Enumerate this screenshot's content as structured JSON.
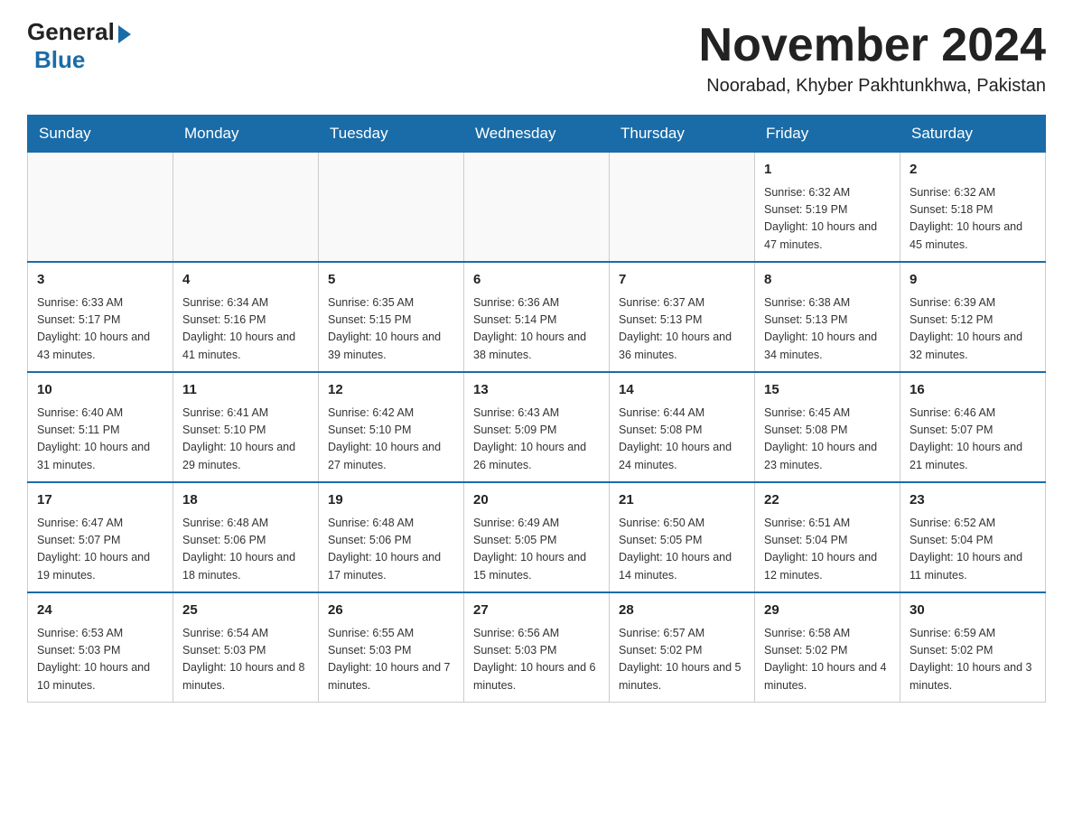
{
  "logo": {
    "general": "General",
    "blue": "Blue"
  },
  "title": "November 2024",
  "location": "Noorabad, Khyber Pakhtunkhwa, Pakistan",
  "days_of_week": [
    "Sunday",
    "Monday",
    "Tuesday",
    "Wednesday",
    "Thursday",
    "Friday",
    "Saturday"
  ],
  "weeks": [
    [
      {
        "day": "",
        "info": ""
      },
      {
        "day": "",
        "info": ""
      },
      {
        "day": "",
        "info": ""
      },
      {
        "day": "",
        "info": ""
      },
      {
        "day": "",
        "info": ""
      },
      {
        "day": "1",
        "info": "Sunrise: 6:32 AM\nSunset: 5:19 PM\nDaylight: 10 hours and 47 minutes."
      },
      {
        "day": "2",
        "info": "Sunrise: 6:32 AM\nSunset: 5:18 PM\nDaylight: 10 hours and 45 minutes."
      }
    ],
    [
      {
        "day": "3",
        "info": "Sunrise: 6:33 AM\nSunset: 5:17 PM\nDaylight: 10 hours and 43 minutes."
      },
      {
        "day": "4",
        "info": "Sunrise: 6:34 AM\nSunset: 5:16 PM\nDaylight: 10 hours and 41 minutes."
      },
      {
        "day": "5",
        "info": "Sunrise: 6:35 AM\nSunset: 5:15 PM\nDaylight: 10 hours and 39 minutes."
      },
      {
        "day": "6",
        "info": "Sunrise: 6:36 AM\nSunset: 5:14 PM\nDaylight: 10 hours and 38 minutes."
      },
      {
        "day": "7",
        "info": "Sunrise: 6:37 AM\nSunset: 5:13 PM\nDaylight: 10 hours and 36 minutes."
      },
      {
        "day": "8",
        "info": "Sunrise: 6:38 AM\nSunset: 5:13 PM\nDaylight: 10 hours and 34 minutes."
      },
      {
        "day": "9",
        "info": "Sunrise: 6:39 AM\nSunset: 5:12 PM\nDaylight: 10 hours and 32 minutes."
      }
    ],
    [
      {
        "day": "10",
        "info": "Sunrise: 6:40 AM\nSunset: 5:11 PM\nDaylight: 10 hours and 31 minutes."
      },
      {
        "day": "11",
        "info": "Sunrise: 6:41 AM\nSunset: 5:10 PM\nDaylight: 10 hours and 29 minutes."
      },
      {
        "day": "12",
        "info": "Sunrise: 6:42 AM\nSunset: 5:10 PM\nDaylight: 10 hours and 27 minutes."
      },
      {
        "day": "13",
        "info": "Sunrise: 6:43 AM\nSunset: 5:09 PM\nDaylight: 10 hours and 26 minutes."
      },
      {
        "day": "14",
        "info": "Sunrise: 6:44 AM\nSunset: 5:08 PM\nDaylight: 10 hours and 24 minutes."
      },
      {
        "day": "15",
        "info": "Sunrise: 6:45 AM\nSunset: 5:08 PM\nDaylight: 10 hours and 23 minutes."
      },
      {
        "day": "16",
        "info": "Sunrise: 6:46 AM\nSunset: 5:07 PM\nDaylight: 10 hours and 21 minutes."
      }
    ],
    [
      {
        "day": "17",
        "info": "Sunrise: 6:47 AM\nSunset: 5:07 PM\nDaylight: 10 hours and 19 minutes."
      },
      {
        "day": "18",
        "info": "Sunrise: 6:48 AM\nSunset: 5:06 PM\nDaylight: 10 hours and 18 minutes."
      },
      {
        "day": "19",
        "info": "Sunrise: 6:48 AM\nSunset: 5:06 PM\nDaylight: 10 hours and 17 minutes."
      },
      {
        "day": "20",
        "info": "Sunrise: 6:49 AM\nSunset: 5:05 PM\nDaylight: 10 hours and 15 minutes."
      },
      {
        "day": "21",
        "info": "Sunrise: 6:50 AM\nSunset: 5:05 PM\nDaylight: 10 hours and 14 minutes."
      },
      {
        "day": "22",
        "info": "Sunrise: 6:51 AM\nSunset: 5:04 PM\nDaylight: 10 hours and 12 minutes."
      },
      {
        "day": "23",
        "info": "Sunrise: 6:52 AM\nSunset: 5:04 PM\nDaylight: 10 hours and 11 minutes."
      }
    ],
    [
      {
        "day": "24",
        "info": "Sunrise: 6:53 AM\nSunset: 5:03 PM\nDaylight: 10 hours and 10 minutes."
      },
      {
        "day": "25",
        "info": "Sunrise: 6:54 AM\nSunset: 5:03 PM\nDaylight: 10 hours and 8 minutes."
      },
      {
        "day": "26",
        "info": "Sunrise: 6:55 AM\nSunset: 5:03 PM\nDaylight: 10 hours and 7 minutes."
      },
      {
        "day": "27",
        "info": "Sunrise: 6:56 AM\nSunset: 5:03 PM\nDaylight: 10 hours and 6 minutes."
      },
      {
        "day": "28",
        "info": "Sunrise: 6:57 AM\nSunset: 5:02 PM\nDaylight: 10 hours and 5 minutes."
      },
      {
        "day": "29",
        "info": "Sunrise: 6:58 AM\nSunset: 5:02 PM\nDaylight: 10 hours and 4 minutes."
      },
      {
        "day": "30",
        "info": "Sunrise: 6:59 AM\nSunset: 5:02 PM\nDaylight: 10 hours and 3 minutes."
      }
    ]
  ]
}
